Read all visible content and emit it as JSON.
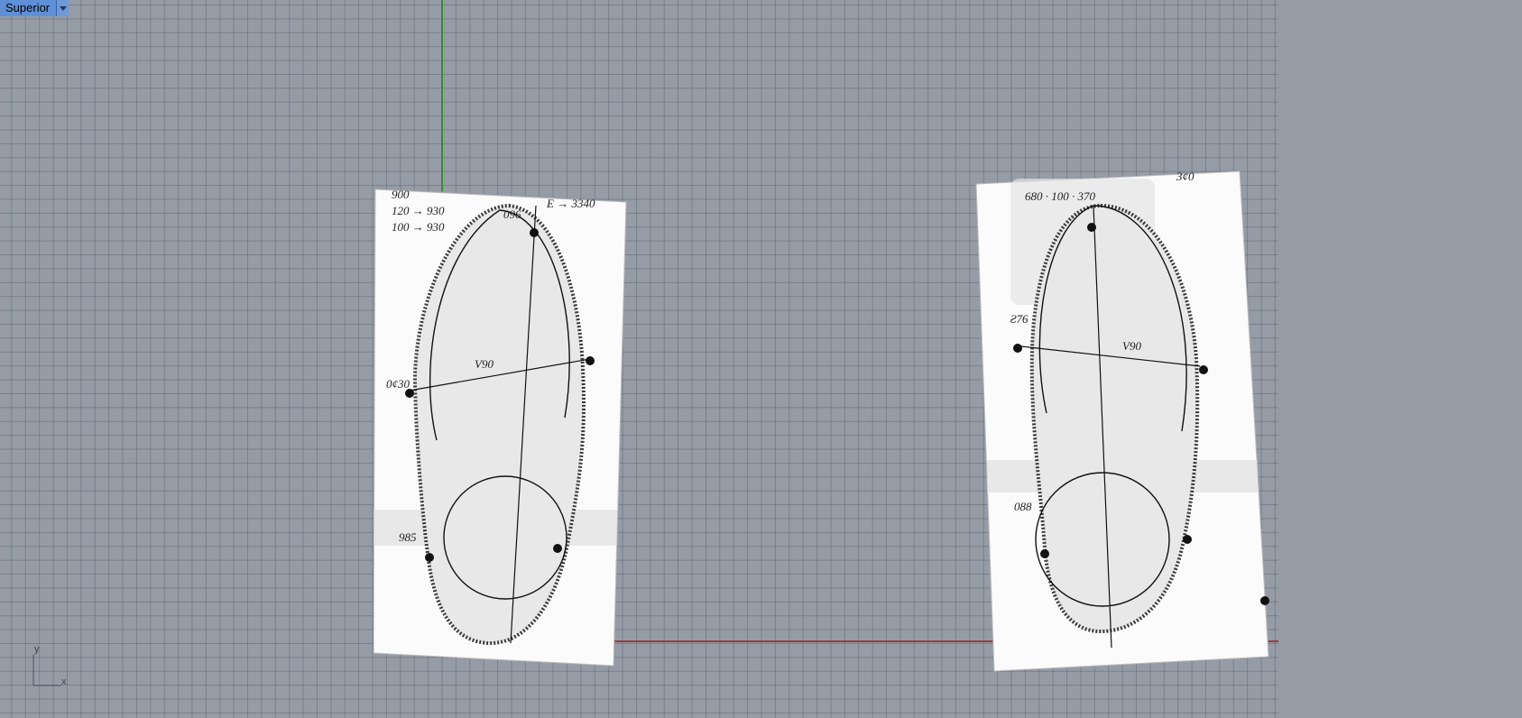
{
  "viewport": {
    "title": "Superior"
  },
  "axes_indicator": {
    "y_label": "y",
    "x_label": "x"
  },
  "left_scan": {
    "notes": [
      "900",
      "120 → 930",
      "100 → 930",
      "096",
      "E → 3340",
      "V90",
      "0¢30",
      "985"
    ]
  },
  "right_scan": {
    "notes": [
      "680 · 100 · 370",
      "3¢0",
      "Ƨ76",
      "V90",
      "088"
    ]
  },
  "colors": {
    "background": "#959ca6",
    "grid": "#6e7684",
    "y_axis": "#2f8f2f",
    "x_axis": "#9b3b3b",
    "tab": "#5f8fd6"
  }
}
